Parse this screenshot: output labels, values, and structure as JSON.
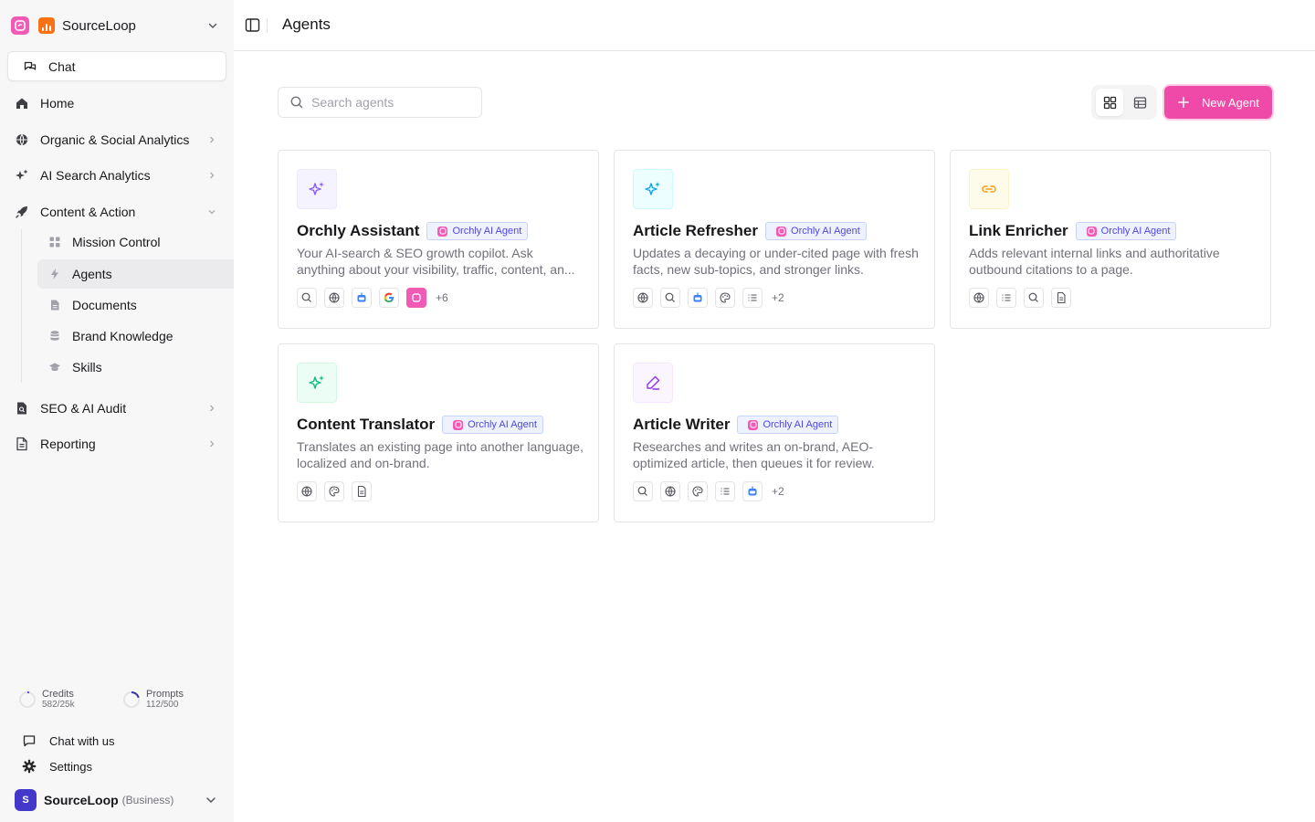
{
  "workspace": {
    "name": "SourceLoop"
  },
  "sidebar": {
    "chat_label": "Chat",
    "items": [
      {
        "label": "Home"
      },
      {
        "label": "Organic & Social Analytics"
      },
      {
        "label": "AI Search Analytics"
      },
      {
        "label": "Content & Action"
      },
      {
        "label": "SEO & AI Audit"
      },
      {
        "label": "Reporting"
      }
    ],
    "sub_items": [
      {
        "label": "Mission Control"
      },
      {
        "label": "Agents",
        "active": true
      },
      {
        "label": "Documents"
      },
      {
        "label": "Brand Knowledge"
      },
      {
        "label": "Skills"
      }
    ],
    "usage": {
      "credits_label": "Credits",
      "credits_value": "582/25k",
      "prompts_label": "Prompts",
      "prompts_value": "112/500"
    },
    "footer": {
      "chat_with_us": "Chat with us",
      "settings": "Settings"
    },
    "account": {
      "initial": "S",
      "name": "SourceLoop",
      "plan": "(Business)"
    }
  },
  "header": {
    "title": "Agents"
  },
  "toolbar": {
    "search_placeholder": "Search agents",
    "new_agent_label": "New Agent"
  },
  "badge_label": "Orchly AI Agent",
  "cards": [
    {
      "title": "Orchly Assistant",
      "description": "Your AI-search & SEO growth copilot. Ask anything about your visibility, traffic, content, an...",
      "more": "+6",
      "icon_color": "#8b5cf6",
      "icon_bg": "#f5f3ff"
    },
    {
      "title": "Article Refresher",
      "description": "Updates a decaying or under-cited page with fresh facts, new sub-topics, and stronger links.",
      "more": "+2",
      "icon_color": "#0ea5e9",
      "icon_bg": "#ecfeff"
    },
    {
      "title": "Link Enricher",
      "description": "Adds relevant internal links and authoritative outbound citations to a page.",
      "more": "",
      "icon_color": "#f59e0b",
      "icon_bg": "#fffbeb"
    },
    {
      "title": "Content Translator",
      "description": "Translates an existing page into another language, localized and on-brand.",
      "more": "",
      "icon_color": "#10b981",
      "icon_bg": "#ecfdf5"
    },
    {
      "title": "Article Writer",
      "description": "Researches and writes an on-brand, AEO-optimized article, then queues it for review.",
      "more": "+2",
      "icon_color": "#9333ea",
      "icon_bg": "#faf5ff"
    }
  ],
  "colors": {
    "accent": "#f04aa8",
    "badge_text": "#4f46e5",
    "sidebar_bg": "#f7f7f8"
  }
}
